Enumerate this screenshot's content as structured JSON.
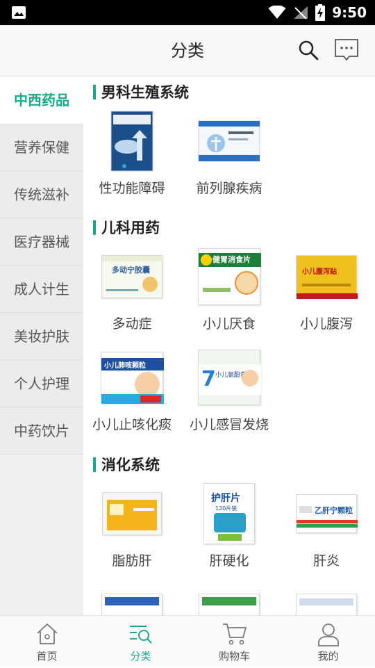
{
  "status_bar": {
    "time": "9:50"
  },
  "header": {
    "title": "分类"
  },
  "sidebar": {
    "items": [
      {
        "label": "中西药品",
        "active": true
      },
      {
        "label": "营养保健",
        "active": false
      },
      {
        "label": "传统滋补",
        "active": false
      },
      {
        "label": "医疗器械",
        "active": false
      },
      {
        "label": "成人计生",
        "active": false
      },
      {
        "label": "美妆护肤",
        "active": false
      },
      {
        "label": "个人护理",
        "active": false
      },
      {
        "label": "中药饮片",
        "active": false
      }
    ]
  },
  "sections": [
    {
      "title": "男科生殖系统",
      "products": [
        {
          "label": "性功能障碍"
        },
        {
          "label": "前列腺疾病"
        }
      ]
    },
    {
      "title": "儿科用药",
      "products": [
        {
          "label": "多动症",
          "box_text": "多动宁胶囊"
        },
        {
          "label": "小儿厌食",
          "box_text": "健胃消食片"
        },
        {
          "label": "小儿腹泻",
          "box_text": "小儿腹泻贴"
        },
        {
          "label": "小儿止咳化痰",
          "box_text": "小儿肺咳颗粒"
        },
        {
          "label": "小儿感冒发烧",
          "box_text": "小儿氨酚黄那敏颗粒"
        }
      ]
    },
    {
      "title": "消化系统",
      "products": [
        {
          "label": "脂肪肝"
        },
        {
          "label": "肝硬化",
          "box_text": "护肝片",
          "box_sub": "120片装"
        },
        {
          "label": "肝炎",
          "box_text": "乙肝宁颗粒"
        }
      ]
    }
  ],
  "tabbar": {
    "tabs": [
      {
        "label": "首页",
        "icon": "home-icon",
        "active": false
      },
      {
        "label": "分类",
        "icon": "category-icon",
        "active": true
      },
      {
        "label": "购物车",
        "icon": "cart-icon",
        "active": false
      },
      {
        "label": "我的",
        "icon": "profile-icon",
        "active": false
      }
    ]
  },
  "colors": {
    "accent": "#1ba98a",
    "header_bg": "#f7f7f7",
    "sidebar_bg": "#ececec"
  }
}
